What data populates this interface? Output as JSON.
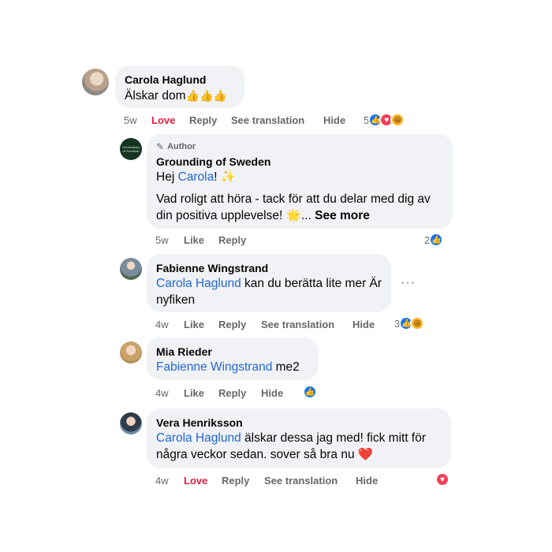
{
  "comments": [
    {
      "author": "Carola Haglund",
      "text": "Älskar dom",
      "emoji": "👍👍👍",
      "time": "5w",
      "actions": [
        "Love",
        "Reply",
        "See translation",
        "Hide"
      ],
      "reaction_count": "5",
      "reaction_icons": [
        "like-icon",
        "love-icon",
        "haha-icon"
      ]
    },
    {
      "author_badge": "Author",
      "author_badge_icon": "pencil-icon",
      "author": "Grounding of Sweden",
      "avatar_text": "Grounding of Sweden",
      "greeting_prefix": "Hej ",
      "greeting_mention": "Carola",
      "greeting_suffix": "! ✨",
      "body": "Vad roligt att höra - tack för att du delar med dig av din positiva upplevelse! 🌟...",
      "see_more": "See more",
      "time": "5w",
      "actions": [
        "Like",
        "Reply"
      ],
      "reaction_count": "2",
      "reaction_icons": [
        "like-icon"
      ]
    },
    {
      "author": "Fabienne Wingstrand",
      "mention": "Carola Haglund",
      "text": " kan du berätta lite mer Är nyfiken",
      "time": "4w",
      "actions": [
        "Like",
        "Reply",
        "See translation",
        "Hide"
      ],
      "reaction_count": "3",
      "reaction_icons": [
        "like-icon",
        "haha-icon"
      ],
      "options_icon": "more-options-icon"
    },
    {
      "author": "Mia Rieder",
      "mention": "Fabienne Wingstrand",
      "text": " me2",
      "time": "4w",
      "actions": [
        "Like",
        "Reply",
        "Hide"
      ],
      "reaction_icons": [
        "like-icon"
      ]
    },
    {
      "author": "Vera Henriksson",
      "mention": "Carola Haglund",
      "text": " älskar dessa jag med! fick mitt för några veckor sedan. sover så bra nu ❤️",
      "time": "4w",
      "actions": [
        "Love",
        "Reply",
        "See translation",
        "Hide"
      ],
      "reaction_icons": [
        "love-icon"
      ]
    }
  ],
  "colors": {
    "love": "#e41e3f",
    "mention": "#2266d4",
    "like": "#1877f2",
    "bubble": "#f0f2f5",
    "meta": "#65676b"
  }
}
